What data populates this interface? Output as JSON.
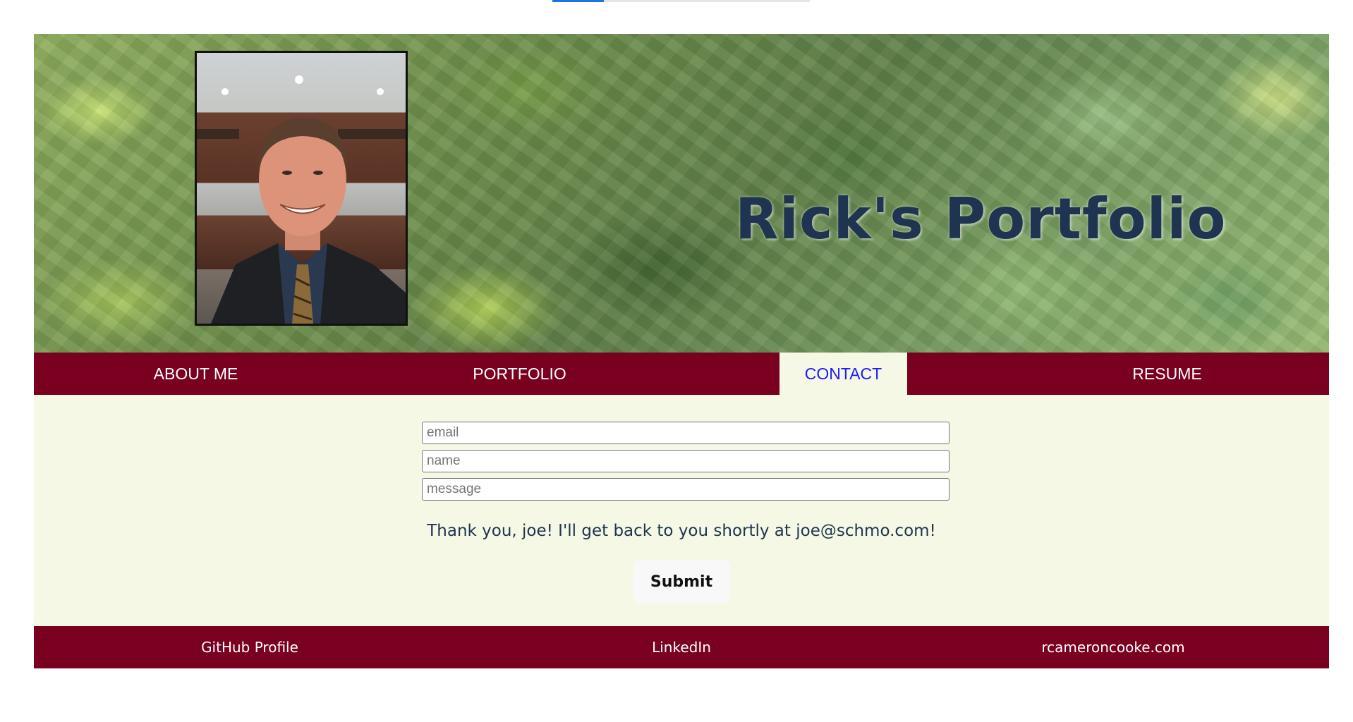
{
  "header": {
    "title": "Rick's Portfolio"
  },
  "nav": {
    "items": [
      {
        "label": "ABOUT ME",
        "active": false
      },
      {
        "label": "PORTFOLIO",
        "active": false
      },
      {
        "label": "CONTACT",
        "active": true
      },
      {
        "label": "RESUME",
        "active": false
      }
    ]
  },
  "contact": {
    "email_placeholder": "email",
    "name_placeholder": "name",
    "message_placeholder": "message",
    "thank_you_message": "Thank you, joe! I'll get back to you shortly at joe@schmo.com!",
    "submit_label": "Submit"
  },
  "footer": {
    "links": [
      {
        "label": "GitHub Profile"
      },
      {
        "label": "LinkedIn"
      },
      {
        "label": "rcameroncooke.com"
      }
    ]
  },
  "colors": {
    "nav_background": "#7a0020",
    "content_background": "#f5f8e4",
    "active_tab_text": "#1a1aff",
    "title_color": "#1f3450"
  },
  "top_progress": {
    "value": 0.2
  }
}
